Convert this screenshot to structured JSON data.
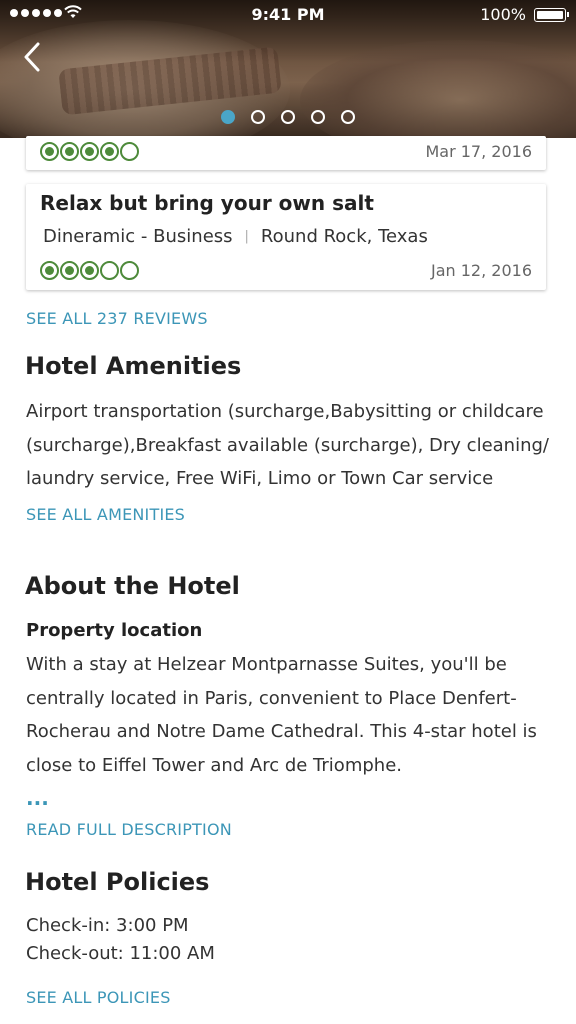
{
  "status_bar": {
    "time": "9:41 PM",
    "battery": "100%",
    "signal_icon": "signal-dots-icon",
    "wifi_icon": "wifi-icon"
  },
  "hero": {
    "back_icon": "chevron-left-icon",
    "carousel": {
      "total": 5,
      "active_index": 0
    }
  },
  "reviews": [
    {
      "rating": 4,
      "max_rating": 5,
      "date": "Mar 17, 2016"
    },
    {
      "title": "Relax but bring your own salt",
      "author": "Dineramic - Business",
      "separator": "|",
      "location": "Round Rock, Texas",
      "rating": 3,
      "max_rating": 5,
      "date": "Jan 12, 2016"
    }
  ],
  "see_all_reviews": "SEE ALL 237 REVIEWS",
  "amenities": {
    "heading": "Hotel Amenities",
    "line1": "Airport transportation (surcharge,Babysitting or childcare",
    "line2": "(surcharge),Breakfast available (surcharge), Dry cleaning/",
    "line3": "laundry service, Free WiFi, Limo or Town Car service",
    "link": "SEE ALL AMENITIES"
  },
  "about": {
    "heading": "About the Hotel",
    "subheading": "Property location",
    "line1": "With a stay at Helzear Montparnasse Suites, you'll be",
    "line2": "centrally located in Paris, convenient to Place Denfert-",
    "line3": "Rocherau and Notre Dame Cathedral. This 4-star hotel is",
    "line4": "close to Eiffel Tower and Arc de Triomphe.",
    "ellipsis": "...",
    "link": "READ FULL DESCRIPTION"
  },
  "policies": {
    "heading": "Hotel Policies",
    "check_in": "Check-in: 3:00 PM",
    "check_out": "Check-out: 11:00 AM",
    "link": "SEE ALL POLICIES"
  },
  "colors": {
    "accent": "#3c96b7",
    "rating_green": "#4d8a3a",
    "carousel_active": "#4aa6c8"
  }
}
